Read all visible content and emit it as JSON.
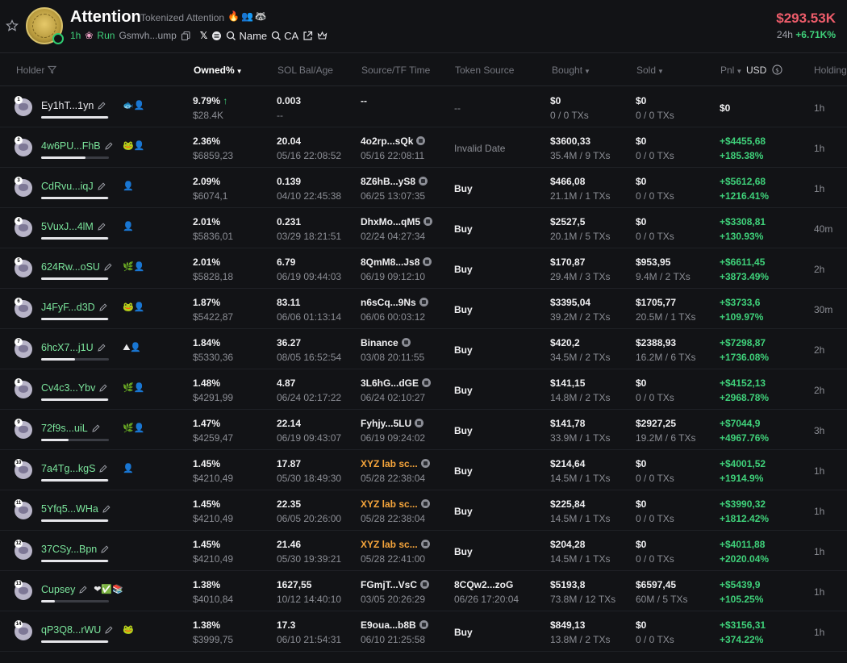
{
  "token": {
    "name": "Attention",
    "subtitle": "Tokenized Attention",
    "emojis": "🔥👥🦝",
    "age": "1h",
    "run_label": "Run",
    "address": "Gsmvh...ump",
    "search_name": "Name",
    "search_ca": "CA"
  },
  "price": {
    "value": "$293.53K",
    "change_label": "24h",
    "change_value": "+6.71K%"
  },
  "columns": {
    "holder": "Holder",
    "owned": "Owned%",
    "sol": "SOL Bal/Age",
    "source": "Source/TF Time",
    "token_source": "Token Source",
    "bought": "Bought",
    "sold": "Sold",
    "pnl": "Pnl",
    "currency": "USD",
    "holding": "Holding"
  },
  "colors": {
    "positive": "#3fd17a",
    "negative": "#ef5d6b",
    "orange": "#f6a53b"
  },
  "rows": [
    {
      "rank": "1",
      "holder": "Ey1hT...1yn",
      "green": false,
      "tags": "🐟👤",
      "bar": 0.99,
      "pct": "9.79%",
      "pct_arrow": "↑",
      "usd": "$28.4K",
      "sol": "0.003",
      "age": "--",
      "src": "--",
      "src_orange": false,
      "tf": "",
      "token_source": "--",
      "ts_dim": true,
      "bought": "$0",
      "bought_tx": "0 / 0 TXs",
      "sold": "$0",
      "sold_tx": "0 / 0 TXs",
      "pnl": "$0",
      "pnl_pct": "",
      "holding": "1h"
    },
    {
      "rank": "2",
      "holder": "4w6PU...FhB",
      "green": true,
      "tags": "🐸👤",
      "bar": 0.66,
      "pct": "2.36%",
      "pct_arrow": "",
      "usd": "$6859,23",
      "sol": "20.04",
      "age": "05/16 22:08:52",
      "src": "4o2rp...sQk",
      "src_orange": false,
      "tf": "05/16 22:08:11",
      "token_source": "Invalid Date",
      "ts_dim": true,
      "bought": "$3600,33",
      "bought_tx": "35.4M / 9 TXs",
      "sold": "$0",
      "sold_tx": "0 / 0 TXs",
      "pnl": "+$4455,68",
      "pnl_pct": "+185.38%",
      "holding": "1h"
    },
    {
      "rank": "3",
      "holder": "CdRvu...iqJ",
      "green": true,
      "tags": "👤",
      "bar": 0.99,
      "pct": "2.09%",
      "pct_arrow": "",
      "usd": "$6074,1",
      "sol": "0.139",
      "age": "04/10 22:45:38",
      "src": "8Z6hB...yS8",
      "src_orange": false,
      "tf": "06/25 13:07:35",
      "token_source": "Buy",
      "ts_dim": false,
      "bought": "$466,08",
      "bought_tx": "21.1M / 1 TXs",
      "sold": "$0",
      "sold_tx": "0 / 0 TXs",
      "pnl": "+$5612,68",
      "pnl_pct": "+1216.41%",
      "holding": "1h"
    },
    {
      "rank": "4",
      "holder": "5VuxJ...4lM",
      "green": true,
      "tags": "👤",
      "bar": 0.99,
      "pct": "2.01%",
      "pct_arrow": "",
      "usd": "$5836,01",
      "sol": "0.231",
      "age": "03/29 18:21:51",
      "src": "DhxMo...qM5",
      "src_orange": false,
      "tf": "02/24 04:27:34",
      "token_source": "Buy",
      "ts_dim": false,
      "bought": "$2527,5",
      "bought_tx": "20.1M / 5 TXs",
      "sold": "$0",
      "sold_tx": "0 / 0 TXs",
      "pnl": "+$3308,81",
      "pnl_pct": "+130.93%",
      "holding": "40m"
    },
    {
      "rank": "5",
      "holder": "624Rw...oSU",
      "green": true,
      "tags": "🌿👤",
      "bar": 0.99,
      "pct": "2.01%",
      "pct_arrow": "",
      "usd": "$5828,18",
      "sol": "6.79",
      "age": "06/19 09:44:03",
      "src": "8QmM8...Js8",
      "src_orange": false,
      "tf": "06/19 09:12:10",
      "token_source": "Buy",
      "ts_dim": false,
      "bought": "$170,87",
      "bought_tx": "29.4M / 3 TXs",
      "sold": "$953,95",
      "sold_tx": "9.4M / 2 TXs",
      "pnl": "+$6611,45",
      "pnl_pct": "+3873.49%",
      "holding": "2h"
    },
    {
      "rank": "6",
      "holder": "J4FyF...d3D",
      "green": true,
      "tags": "🐸👤",
      "bar": 0.99,
      "pct": "1.87%",
      "pct_arrow": "",
      "usd": "$5422,87",
      "sol": "83.11",
      "age": "06/06 01:13:14",
      "src": "n6sCq...9Ns",
      "src_orange": false,
      "tf": "06/06 00:03:12",
      "token_source": "Buy",
      "ts_dim": false,
      "bought": "$3395,04",
      "bought_tx": "39.2M / 2 TXs",
      "sold": "$1705,77",
      "sold_tx": "20.5M / 1 TXs",
      "pnl": "+$3733,6",
      "pnl_pct": "+109.97%",
      "holding": "30m"
    },
    {
      "rank": "7",
      "holder": "6hcX7...j1U",
      "green": true,
      "tags": "⛰👤",
      "bar": 0.5,
      "pct": "1.84%",
      "pct_arrow": "",
      "usd": "$5330,36",
      "sol": "36.27",
      "age": "08/05 16:52:54",
      "src": "Binance",
      "src_orange": false,
      "tf": "03/08 20:11:55",
      "token_source": "Buy",
      "ts_dim": false,
      "bought": "$420,2",
      "bought_tx": "34.5M / 2 TXs",
      "sold": "$2388,93",
      "sold_tx": "16.2M / 6 TXs",
      "pnl": "+$7298,87",
      "pnl_pct": "+1736.08%",
      "holding": "2h"
    },
    {
      "rank": "8",
      "holder": "Cv4c3...Ybv",
      "green": true,
      "tags": "🌿👤",
      "bar": 0.99,
      "pct": "1.48%",
      "pct_arrow": "",
      "usd": "$4291,99",
      "sol": "4.87",
      "age": "06/24 02:17:22",
      "src": "3L6hG...dGE",
      "src_orange": false,
      "tf": "06/24 02:10:27",
      "token_source": "Buy",
      "ts_dim": false,
      "bought": "$141,15",
      "bought_tx": "14.8M / 2 TXs",
      "sold": "$0",
      "sold_tx": "0 / 0 TXs",
      "pnl": "+$4152,13",
      "pnl_pct": "+2968.78%",
      "holding": "2h"
    },
    {
      "rank": "9",
      "holder": "72f9s...uiL",
      "green": true,
      "tags": "🌿👤",
      "bar": 0.4,
      "pct": "1.47%",
      "pct_arrow": "",
      "usd": "$4259,47",
      "sol": "22.14",
      "age": "06/19 09:43:07",
      "src": "Fyhjy...5LU",
      "src_orange": false,
      "tf": "06/19 09:24:02",
      "token_source": "Buy",
      "ts_dim": false,
      "bought": "$141,78",
      "bought_tx": "33.9M / 1 TXs",
      "sold": "$2927,25",
      "sold_tx": "19.2M / 6 TXs",
      "pnl": "+$7044,9",
      "pnl_pct": "+4967.76%",
      "holding": "3h"
    },
    {
      "rank": "10",
      "holder": "7a4Tg...kgS",
      "green": true,
      "tags": "👤",
      "bar": 0.99,
      "pct": "1.45%",
      "pct_arrow": "",
      "usd": "$4210,49",
      "sol": "17.87",
      "age": "05/30 18:49:30",
      "src": "XYZ lab sc...",
      "src_orange": true,
      "tf": "05/28 22:38:04",
      "token_source": "Buy",
      "ts_dim": false,
      "bought": "$214,64",
      "bought_tx": "14.5M / 1 TXs",
      "sold": "$0",
      "sold_tx": "0 / 0 TXs",
      "pnl": "+$4001,52",
      "pnl_pct": "+1914.9%",
      "holding": "1h"
    },
    {
      "rank": "11",
      "holder": "5Yfq5...WHa",
      "green": true,
      "tags": "",
      "bar": 0.99,
      "pct": "1.45%",
      "pct_arrow": "",
      "usd": "$4210,49",
      "sol": "22.35",
      "age": "06/05 20:26:00",
      "src": "XYZ lab sc...",
      "src_orange": true,
      "tf": "05/28 22:38:04",
      "token_source": "Buy",
      "ts_dim": false,
      "bought": "$225,84",
      "bought_tx": "14.5M / 1 TXs",
      "sold": "$0",
      "sold_tx": "0 / 0 TXs",
      "pnl": "+$3990,32",
      "pnl_pct": "+1812.42%",
      "holding": "1h"
    },
    {
      "rank": "12",
      "holder": "37CSy...Bpn",
      "green": true,
      "tags": "",
      "bar": 0.99,
      "pct": "1.45%",
      "pct_arrow": "",
      "usd": "$4210,49",
      "sol": "21.46",
      "age": "05/30 19:39:21",
      "src": "XYZ lab sc...",
      "src_orange": true,
      "tf": "05/28 22:41:00",
      "token_source": "Buy",
      "ts_dim": false,
      "bought": "$204,28",
      "bought_tx": "14.5M / 1 TXs",
      "sold": "$0",
      "sold_tx": "0 / 0 TXs",
      "pnl": "+$4011,88",
      "pnl_pct": "+2020.04%",
      "holding": "1h"
    },
    {
      "rank": "13",
      "holder": "Cupsey",
      "green": true,
      "tags": "❤✅📚",
      "bar": 0.2,
      "pct": "1.38%",
      "pct_arrow": "",
      "usd": "$4010,84",
      "sol": "1627,55",
      "age": "10/12 14:40:10",
      "src": "FGmjT...VsC",
      "src_orange": false,
      "tf": "03/05 20:26:29",
      "token_source": "8CQw2...zoG",
      "ts_src2": "06/26 17:20:04",
      "ts_dim": false,
      "bought": "$5193,8",
      "bought_tx": "73.8M / 12 TXs",
      "sold": "$6597,45",
      "sold_tx": "60M / 5 TXs",
      "pnl": "+$5439,9",
      "pnl_pct": "+105.25%",
      "holding": "1h"
    },
    {
      "rank": "14",
      "holder": "qP3Q8...rWU",
      "green": true,
      "tags": "🐸",
      "bar": 0.99,
      "pct": "1.38%",
      "pct_arrow": "",
      "usd": "$3999,75",
      "sol": "17.3",
      "age": "06/10 21:54:31",
      "src": "E9oua...b8B",
      "src_orange": false,
      "tf": "06/10 21:25:58",
      "token_source": "Buy",
      "ts_dim": false,
      "bought": "$849,13",
      "bought_tx": "13.8M / 2 TXs",
      "sold": "$0",
      "sold_tx": "0 / 0 TXs",
      "pnl": "+$3156,31",
      "pnl_pct": "+374.22%",
      "holding": "1h"
    }
  ]
}
